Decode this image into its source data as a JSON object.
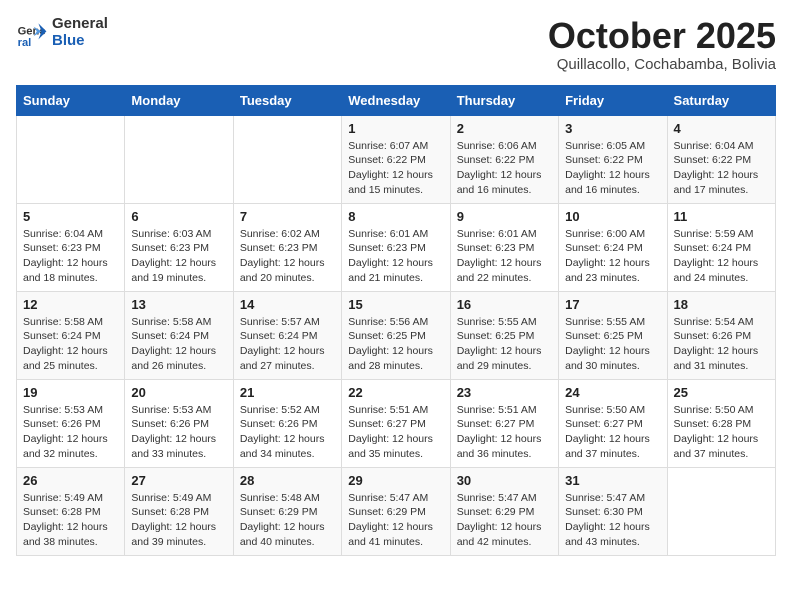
{
  "logo": {
    "general": "General",
    "blue": "Blue"
  },
  "header": {
    "month": "October 2025",
    "location": "Quillacollo, Cochabamba, Bolivia"
  },
  "weekdays": [
    "Sunday",
    "Monday",
    "Tuesday",
    "Wednesday",
    "Thursday",
    "Friday",
    "Saturday"
  ],
  "weeks": [
    [
      {
        "day": "",
        "info": ""
      },
      {
        "day": "",
        "info": ""
      },
      {
        "day": "",
        "info": ""
      },
      {
        "day": "1",
        "info": "Sunrise: 6:07 AM\nSunset: 6:22 PM\nDaylight: 12 hours\nand 15 minutes."
      },
      {
        "day": "2",
        "info": "Sunrise: 6:06 AM\nSunset: 6:22 PM\nDaylight: 12 hours\nand 16 minutes."
      },
      {
        "day": "3",
        "info": "Sunrise: 6:05 AM\nSunset: 6:22 PM\nDaylight: 12 hours\nand 16 minutes."
      },
      {
        "day": "4",
        "info": "Sunrise: 6:04 AM\nSunset: 6:22 PM\nDaylight: 12 hours\nand 17 minutes."
      }
    ],
    [
      {
        "day": "5",
        "info": "Sunrise: 6:04 AM\nSunset: 6:23 PM\nDaylight: 12 hours\nand 18 minutes."
      },
      {
        "day": "6",
        "info": "Sunrise: 6:03 AM\nSunset: 6:23 PM\nDaylight: 12 hours\nand 19 minutes."
      },
      {
        "day": "7",
        "info": "Sunrise: 6:02 AM\nSunset: 6:23 PM\nDaylight: 12 hours\nand 20 minutes."
      },
      {
        "day": "8",
        "info": "Sunrise: 6:01 AM\nSunset: 6:23 PM\nDaylight: 12 hours\nand 21 minutes."
      },
      {
        "day": "9",
        "info": "Sunrise: 6:01 AM\nSunset: 6:23 PM\nDaylight: 12 hours\nand 22 minutes."
      },
      {
        "day": "10",
        "info": "Sunrise: 6:00 AM\nSunset: 6:24 PM\nDaylight: 12 hours\nand 23 minutes."
      },
      {
        "day": "11",
        "info": "Sunrise: 5:59 AM\nSunset: 6:24 PM\nDaylight: 12 hours\nand 24 minutes."
      }
    ],
    [
      {
        "day": "12",
        "info": "Sunrise: 5:58 AM\nSunset: 6:24 PM\nDaylight: 12 hours\nand 25 minutes."
      },
      {
        "day": "13",
        "info": "Sunrise: 5:58 AM\nSunset: 6:24 PM\nDaylight: 12 hours\nand 26 minutes."
      },
      {
        "day": "14",
        "info": "Sunrise: 5:57 AM\nSunset: 6:24 PM\nDaylight: 12 hours\nand 27 minutes."
      },
      {
        "day": "15",
        "info": "Sunrise: 5:56 AM\nSunset: 6:25 PM\nDaylight: 12 hours\nand 28 minutes."
      },
      {
        "day": "16",
        "info": "Sunrise: 5:55 AM\nSunset: 6:25 PM\nDaylight: 12 hours\nand 29 minutes."
      },
      {
        "day": "17",
        "info": "Sunrise: 5:55 AM\nSunset: 6:25 PM\nDaylight: 12 hours\nand 30 minutes."
      },
      {
        "day": "18",
        "info": "Sunrise: 5:54 AM\nSunset: 6:26 PM\nDaylight: 12 hours\nand 31 minutes."
      }
    ],
    [
      {
        "day": "19",
        "info": "Sunrise: 5:53 AM\nSunset: 6:26 PM\nDaylight: 12 hours\nand 32 minutes."
      },
      {
        "day": "20",
        "info": "Sunrise: 5:53 AM\nSunset: 6:26 PM\nDaylight: 12 hours\nand 33 minutes."
      },
      {
        "day": "21",
        "info": "Sunrise: 5:52 AM\nSunset: 6:26 PM\nDaylight: 12 hours\nand 34 minutes."
      },
      {
        "day": "22",
        "info": "Sunrise: 5:51 AM\nSunset: 6:27 PM\nDaylight: 12 hours\nand 35 minutes."
      },
      {
        "day": "23",
        "info": "Sunrise: 5:51 AM\nSunset: 6:27 PM\nDaylight: 12 hours\nand 36 minutes."
      },
      {
        "day": "24",
        "info": "Sunrise: 5:50 AM\nSunset: 6:27 PM\nDaylight: 12 hours\nand 37 minutes."
      },
      {
        "day": "25",
        "info": "Sunrise: 5:50 AM\nSunset: 6:28 PM\nDaylight: 12 hours\nand 37 minutes."
      }
    ],
    [
      {
        "day": "26",
        "info": "Sunrise: 5:49 AM\nSunset: 6:28 PM\nDaylight: 12 hours\nand 38 minutes."
      },
      {
        "day": "27",
        "info": "Sunrise: 5:49 AM\nSunset: 6:28 PM\nDaylight: 12 hours\nand 39 minutes."
      },
      {
        "day": "28",
        "info": "Sunrise: 5:48 AM\nSunset: 6:29 PM\nDaylight: 12 hours\nand 40 minutes."
      },
      {
        "day": "29",
        "info": "Sunrise: 5:47 AM\nSunset: 6:29 PM\nDaylight: 12 hours\nand 41 minutes."
      },
      {
        "day": "30",
        "info": "Sunrise: 5:47 AM\nSunset: 6:29 PM\nDaylight: 12 hours\nand 42 minutes."
      },
      {
        "day": "31",
        "info": "Sunrise: 5:47 AM\nSunset: 6:30 PM\nDaylight: 12 hours\nand 43 minutes."
      },
      {
        "day": "",
        "info": ""
      }
    ]
  ]
}
